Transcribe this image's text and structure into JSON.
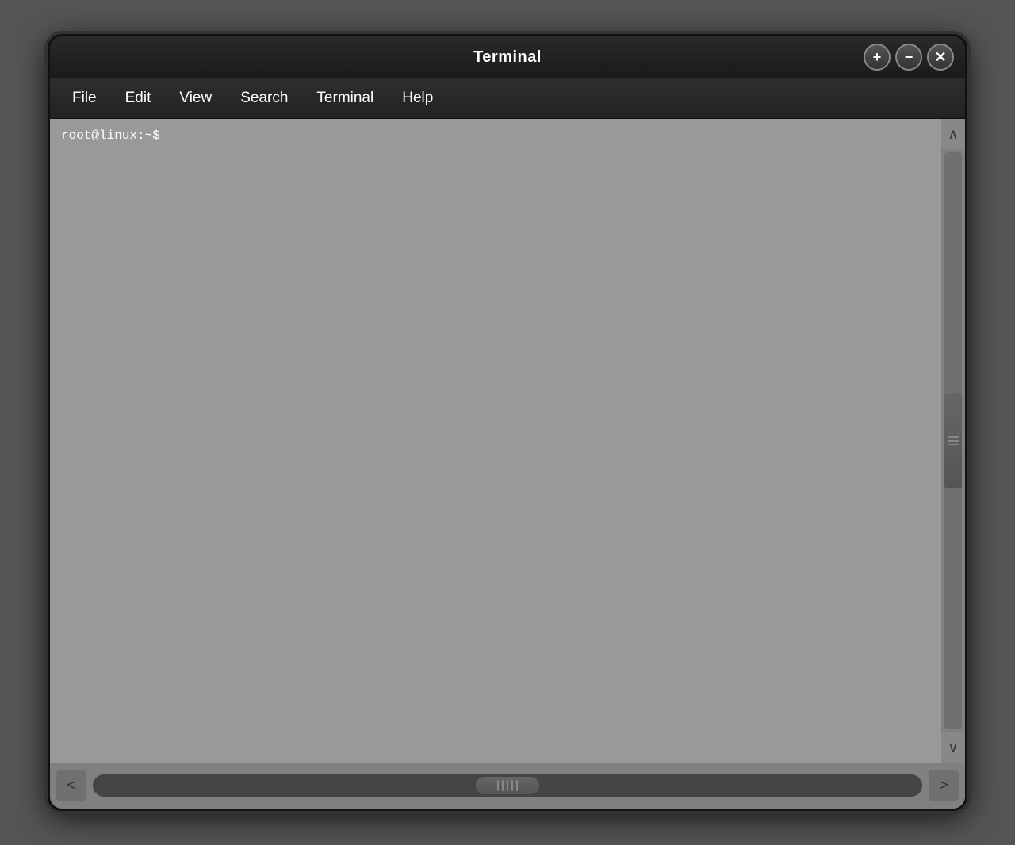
{
  "window": {
    "title": "Terminal",
    "controls": {
      "add_label": "+",
      "minimize_label": "−",
      "close_label": "✕"
    }
  },
  "menubar": {
    "items": [
      {
        "id": "file",
        "label": "File"
      },
      {
        "id": "edit",
        "label": "Edit"
      },
      {
        "id": "view",
        "label": "View"
      },
      {
        "id": "search",
        "label": "Search"
      },
      {
        "id": "terminal",
        "label": "Terminal"
      },
      {
        "id": "help",
        "label": "Help"
      }
    ]
  },
  "terminal": {
    "prompt": "root@linux:~$"
  },
  "scrollbar": {
    "up_arrow": "∧",
    "down_arrow": "∨",
    "left_arrow": "<",
    "right_arrow": ">"
  }
}
